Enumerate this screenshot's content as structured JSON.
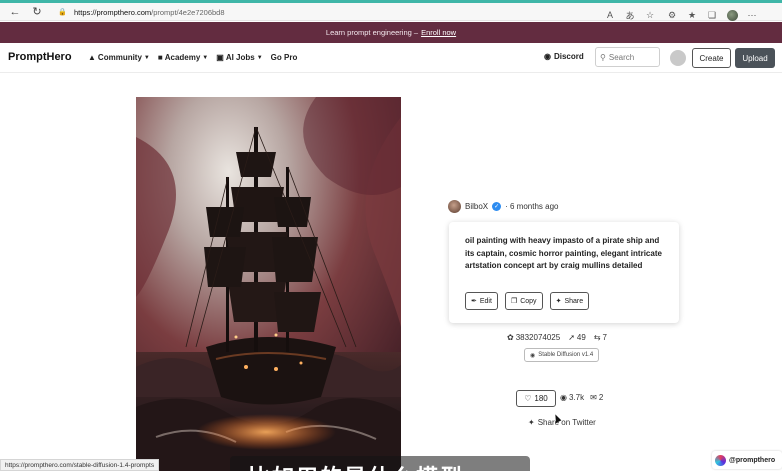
{
  "browser": {
    "url_host": "https://prompthero.com",
    "url_path": "/prompt/4e2e7206bd8",
    "icons": [
      "back-arrow-icon",
      "refresh-icon",
      "lock-icon",
      "read-aloud-icon",
      "translate-icon",
      "favorite-add-icon",
      "extensions-icon",
      "favorites-icon",
      "collections-icon",
      "profile-icon"
    ]
  },
  "banner": {
    "text": "Learn prompt engineering –",
    "link": "Enroll now"
  },
  "nav": {
    "logo": "PromptHero",
    "items": [
      {
        "label": "Community",
        "icon": "community-icon"
      },
      {
        "label": "Academy",
        "icon": "graduation-cap-icon"
      },
      {
        "label": "AI Jobs",
        "icon": "briefcase-icon"
      },
      {
        "label": "Go Pro",
        "icon": ""
      }
    ],
    "discord": "Discord",
    "search_placeholder": "Search",
    "create": "Create",
    "upload": "Upload"
  },
  "prompt": {
    "author": "BilboX",
    "time_ago": "· 6 months ago",
    "text": "oil painting with heavy impasto of a pirate ship and its captain, cosmic horror painting, elegant intricate artstation concept art by craig mullins detailed",
    "actions": {
      "edit": "Edit",
      "copy": "Copy",
      "share": "Share"
    }
  },
  "stats": {
    "seed": "3832074025",
    "steps": "49",
    "cfg": "7",
    "model": "Stable Diffusion v1.4",
    "likes": "180",
    "views": "3.7k",
    "comments": "2",
    "share_twitter": "Share on Twitter"
  },
  "overlay": {
    "status_url": "https://prompthero.com/stable-diffusion-1.4-prompts",
    "subtitle": "比如用的是什么模型",
    "handle": "@prompthero"
  },
  "colors": {
    "banner": "#632c40",
    "upload_button": "#4b5259",
    "verified": "#2d8cf0",
    "browser_accent": "#3fb6a8"
  }
}
